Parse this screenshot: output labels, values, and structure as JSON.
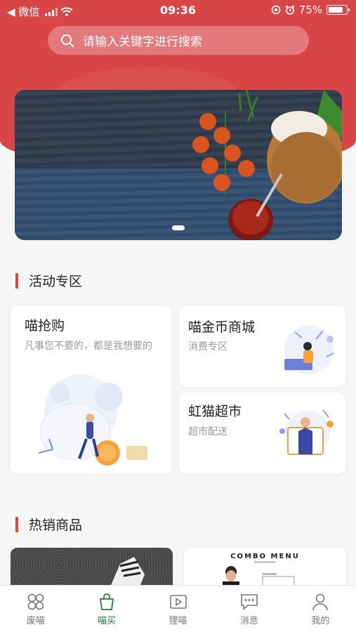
{
  "status_bar": {
    "carrier": "◀ 微信",
    "time": "09:36",
    "battery": "75%"
  },
  "search": {
    "placeholder": "请输入关键字进行搜索"
  },
  "sections": {
    "activity_title": "活动专区",
    "hot_title": "热销商品"
  },
  "cards": {
    "flash_sale": {
      "title": "喵抢购",
      "subtitle": "凡事您不要的，都是我想要的"
    },
    "coin_mall": {
      "title": "喵金币商城",
      "subtitle": "消费专区"
    },
    "supermarket": {
      "title": "虹猫超市",
      "subtitle": "超市配送"
    }
  },
  "products": {
    "combo_menu": "COMBO MENU"
  },
  "tabbar": {
    "items": [
      {
        "label": "废喵",
        "icon": "grid-icon"
      },
      {
        "label": "喵买",
        "icon": "shopping-bag-icon",
        "active": true
      },
      {
        "label": "狸喵",
        "icon": "play-icon"
      },
      {
        "label": "消息",
        "icon": "message-icon"
      },
      {
        "label": "我的",
        "icon": "user-icon"
      }
    ]
  },
  "colors": {
    "brand_red": "#d94647",
    "active_green": "#2b7a3c"
  }
}
